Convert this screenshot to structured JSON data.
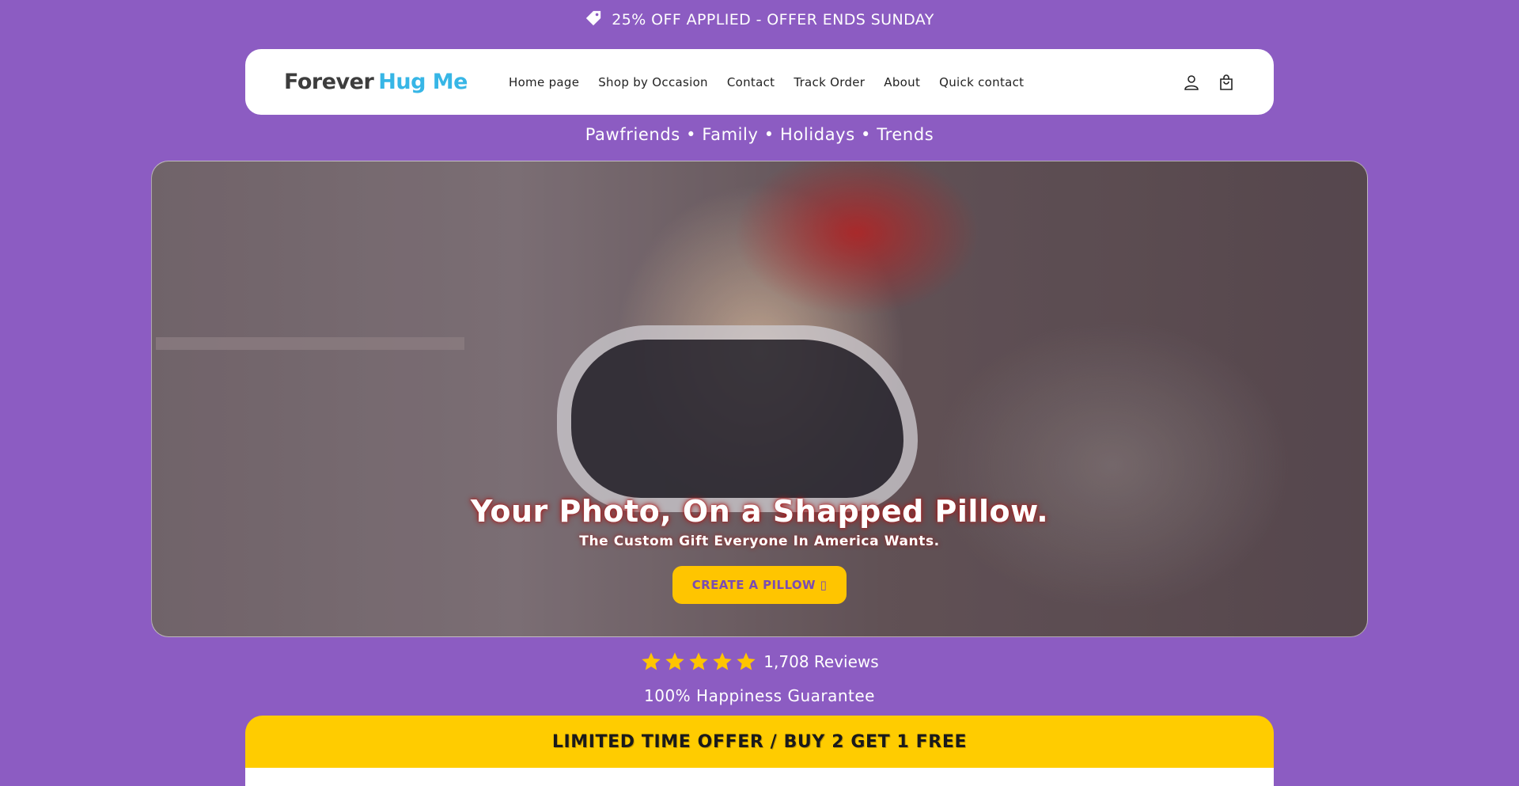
{
  "announcement": {
    "text": "25% OFF APPLIED - OFFER ENDS SUNDAY",
    "icon": "tag-icon"
  },
  "header": {
    "logo_part1": "Forever",
    "logo_part2": "Hug Me",
    "nav": [
      "Home page",
      "Shop by Occasion",
      "Contact",
      "Track Order",
      "About",
      "Quick contact"
    ],
    "icons": [
      "account-icon",
      "cart-icon"
    ]
  },
  "subnav": {
    "text": "Pawfriends • Family • Holidays • Trends"
  },
  "hero": {
    "title": "Your Photo, On a Shapped Pillow.",
    "subtitle": "The Custom Gift Everyone In America Wants.",
    "cta_label": "CREATE A PILLOW ▯"
  },
  "rating": {
    "stars": 5,
    "reviews_text": "1,708 Reviews"
  },
  "guarantee": {
    "text": "100% Happiness Guarantee"
  },
  "offer_banner": {
    "text": "LIMITED TIME OFFER  / BUY 2 GET 1 FREE"
  },
  "colors": {
    "background": "#8c5cc2",
    "accent_yellow": "#ffcc00",
    "logo_blue": "#37b6e6",
    "star_color": "#ffc500"
  }
}
